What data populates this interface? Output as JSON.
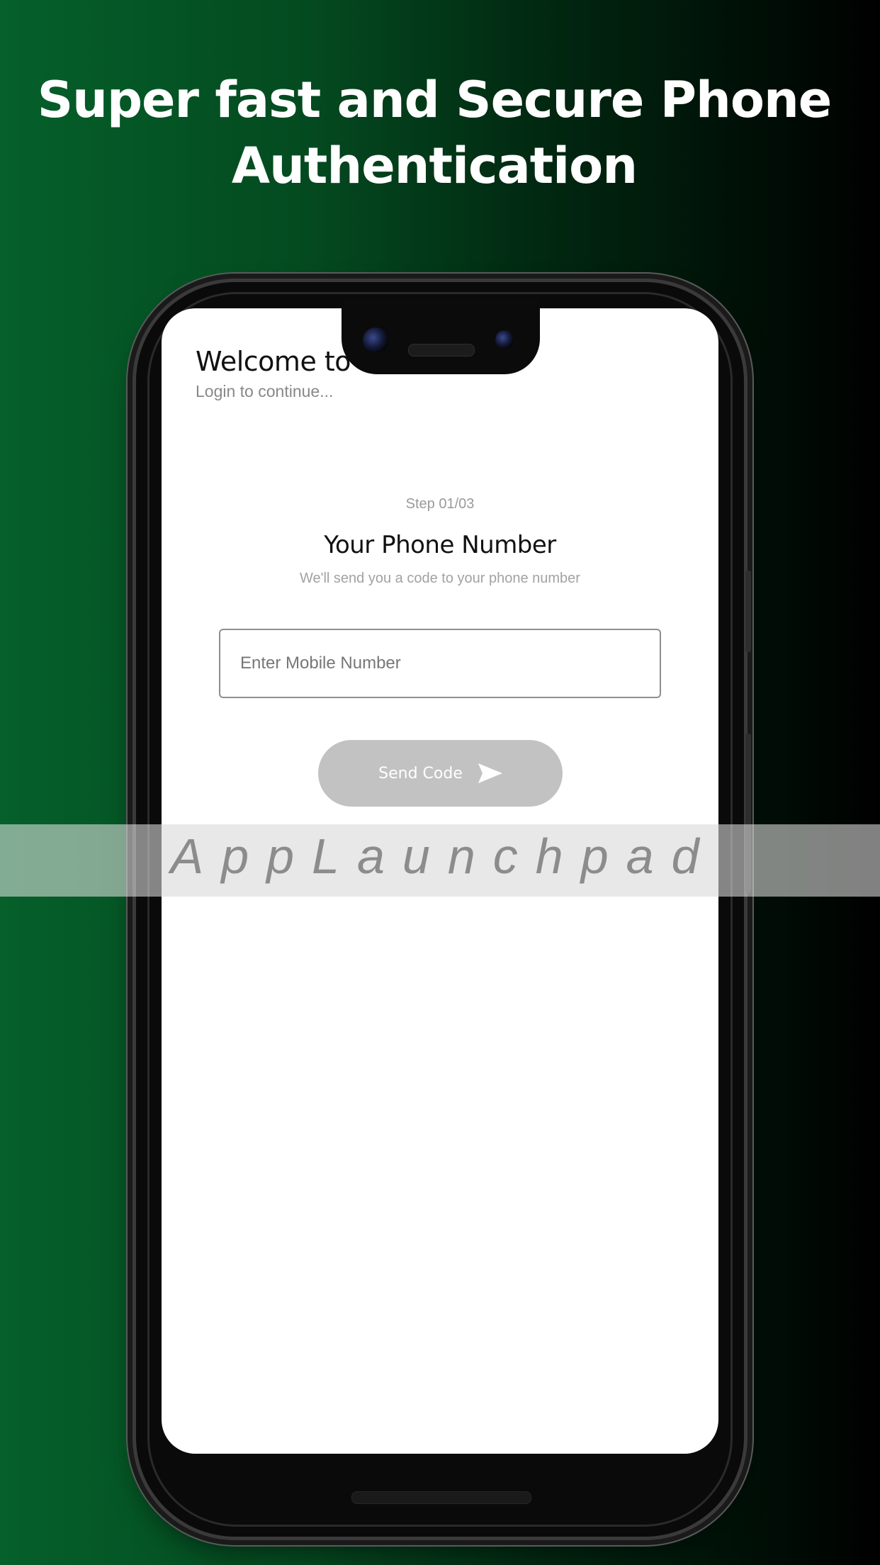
{
  "promo": {
    "title": "Super fast and Secure Phone Authentication"
  },
  "app": {
    "welcome_title": "Welcome to C",
    "welcome_subtitle": "Login to continue...",
    "step_label": "Step 01/03",
    "heading": "Your Phone Number",
    "description": "We'll send you a code to your phone number",
    "mobile_input": {
      "placeholder": "Enter Mobile Number",
      "value": ""
    },
    "send_button": {
      "label": "Send Code",
      "icon": "send-icon",
      "enabled": false
    }
  },
  "watermark": {
    "text": "AppLaunchpad"
  },
  "colors": {
    "background_start": "#05602a",
    "background_end": "#000000",
    "button_disabled": "#c2c2c2",
    "title_text": "#ffffff"
  }
}
